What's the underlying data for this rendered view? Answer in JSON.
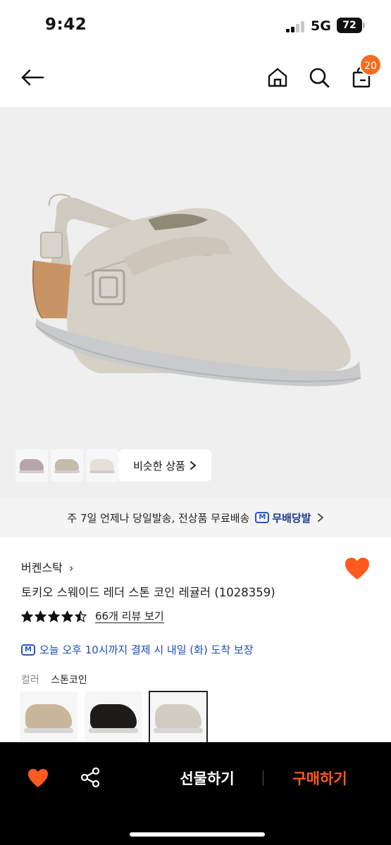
{
  "status_bar": {
    "time": "9:42",
    "network": "5G",
    "battery": "72"
  },
  "nav": {
    "cart_count": "20"
  },
  "gallery": {
    "similar_products_label": "비슷한 상품",
    "thumbnails": [
      {
        "color": "#b7a4ad"
      },
      {
        "color": "#c4bba9"
      },
      {
        "color": "#e4e0d6"
      }
    ]
  },
  "shipping": {
    "text": "주 7일 언제나 당일발송, 전상품 무료배송",
    "brand": "무배당발",
    "badge": "M"
  },
  "product": {
    "brand": "버켄스탁",
    "title": "토키오 스웨이드 레더 스톤 코인 레귤러 (1028359)",
    "rating": 4.5,
    "review_link": "66개 리뷰 보기",
    "delivery_text": "오늘 오후 10시까지 결제 시 내일 (화) 도착 보장",
    "color_label": "컬러",
    "color_value": "스톤코인",
    "swatches": [
      {
        "color": "#c9b79c",
        "selected": false
      },
      {
        "color": "#1e1c1b",
        "selected": false
      },
      {
        "color": "#d2cdc3",
        "selected": true
      }
    ]
  },
  "bottom_bar": {
    "gift_label": "선물하기",
    "buy_label": "구매하기"
  },
  "colors": {
    "accent": "#f36c21",
    "buy": "#ff5a1f",
    "delivery": "#1e4db8",
    "heart": "#ff5a1f"
  }
}
